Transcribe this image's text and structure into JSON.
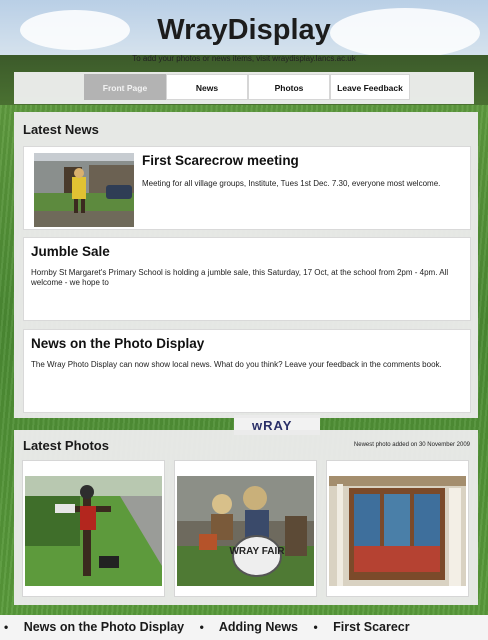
{
  "header": {
    "title": "WrayDisplay",
    "tagline": "To add your photos or news items, visit wraydisplay.lancs.ac.uk"
  },
  "nav": {
    "tabs": [
      {
        "label": "Front Page",
        "active": true
      },
      {
        "label": "News",
        "active": false
      },
      {
        "label": "Photos",
        "active": false
      },
      {
        "label": "Leave Feedback",
        "active": false
      }
    ]
  },
  "latest_news": {
    "heading": "Latest News",
    "items": [
      {
        "title": "First Scarecrow meeting",
        "body": "Meeting for all village groups, Institute, Tues 1st Dec. 7.30, everyone most welcome.",
        "image": "scarecrow-photo"
      },
      {
        "title": "Jumble Sale",
        "body": "Hornby St Margaret's Primary School is holding a jumble sale, this Saturday, 17 Oct, at the school from 2pm - 4pm. All welcome - we hope to"
      },
      {
        "title": "News on the Photo Display",
        "body": "The Wray Photo Display can now show local news. What do you think? Leave your feedback in the comments book."
      }
    ]
  },
  "latest_photos": {
    "heading": "Latest Photos",
    "newest_note": "Newest photo added on 30 November 2009",
    "photos": [
      {
        "image": "scarecrow-roadside-photo"
      },
      {
        "image": "wray-fair-scarecrows-photo",
        "caption": "WRAY FAIR"
      },
      {
        "image": "shop-window-photo"
      }
    ]
  },
  "background": {
    "sign_text": "wRAY"
  },
  "ticker": {
    "items": [
      "News on the Photo Display",
      "Adding News",
      "First Scarecr"
    ],
    "separator": "•"
  },
  "colors": {
    "nav_active_bg": "#b3b3b3",
    "panel_bg": "#eaeaea",
    "card_bg": "#ffffff"
  }
}
